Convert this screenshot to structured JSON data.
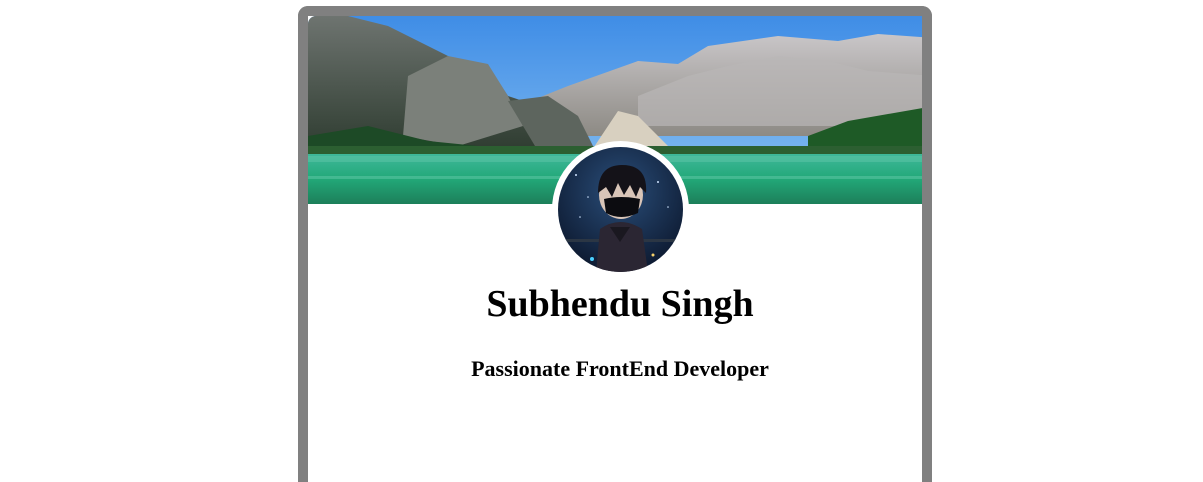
{
  "profile": {
    "name": "Subhendu Singh",
    "tagline": "Passionate FrontEnd Developer"
  },
  "banner": {
    "icon": "mountain-lake-landscape",
    "colors": {
      "sky": "#4a90e2",
      "lake": "#2fb38a",
      "forest": "#1f5a2a",
      "rock": "#9a9a9a"
    }
  },
  "avatar": {
    "icon": "masked-anime-boy",
    "background": "#0f1e36"
  },
  "card": {
    "border_color": "#808080"
  }
}
